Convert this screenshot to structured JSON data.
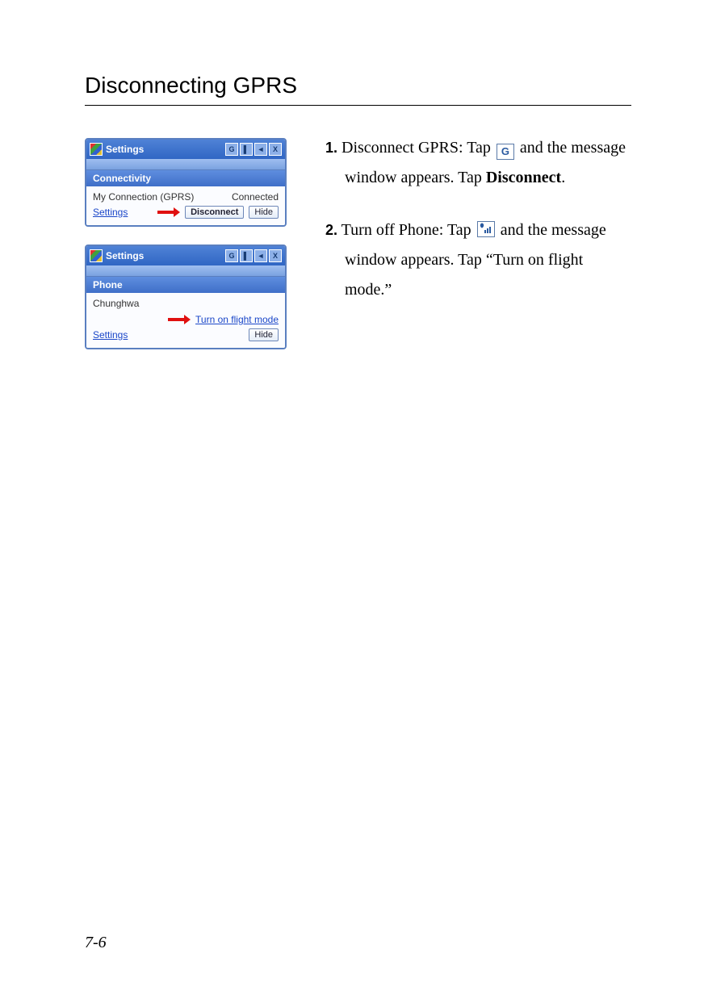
{
  "heading": "Disconnecting GPRS",
  "page_number": "7-6",
  "steps": [
    {
      "num": "1.",
      "pre": " Disconnect GPRS: Tap ",
      "icon_label": "G",
      "mid": " and the message window appears. Tap ",
      "bold": "Disconnect",
      "post": "."
    },
    {
      "num": "2.",
      "pre": " Turn off Phone: Tap ",
      "icon_label": "signal",
      "mid": " and the message window appears. Tap ",
      "quoted": "“Turn on flight mode.”",
      "post": ""
    }
  ],
  "panel1": {
    "title": "Settings",
    "tray": [
      "G",
      "▌",
      "◄",
      "X"
    ],
    "section": "Connectivity",
    "conn_name": "My Connection (GPRS)",
    "conn_status": "Connected",
    "settings_link": "Settings",
    "btn_disconnect": "Disconnect",
    "btn_hide": "Hide"
  },
  "panel2": {
    "title": "Settings",
    "tray": [
      "G",
      "▌",
      "◄",
      "X"
    ],
    "section": "Phone",
    "carrier": "Chunghwa",
    "flight_link": "Turn on flight mode",
    "settings_link": "Settings",
    "btn_hide": "Hide"
  }
}
